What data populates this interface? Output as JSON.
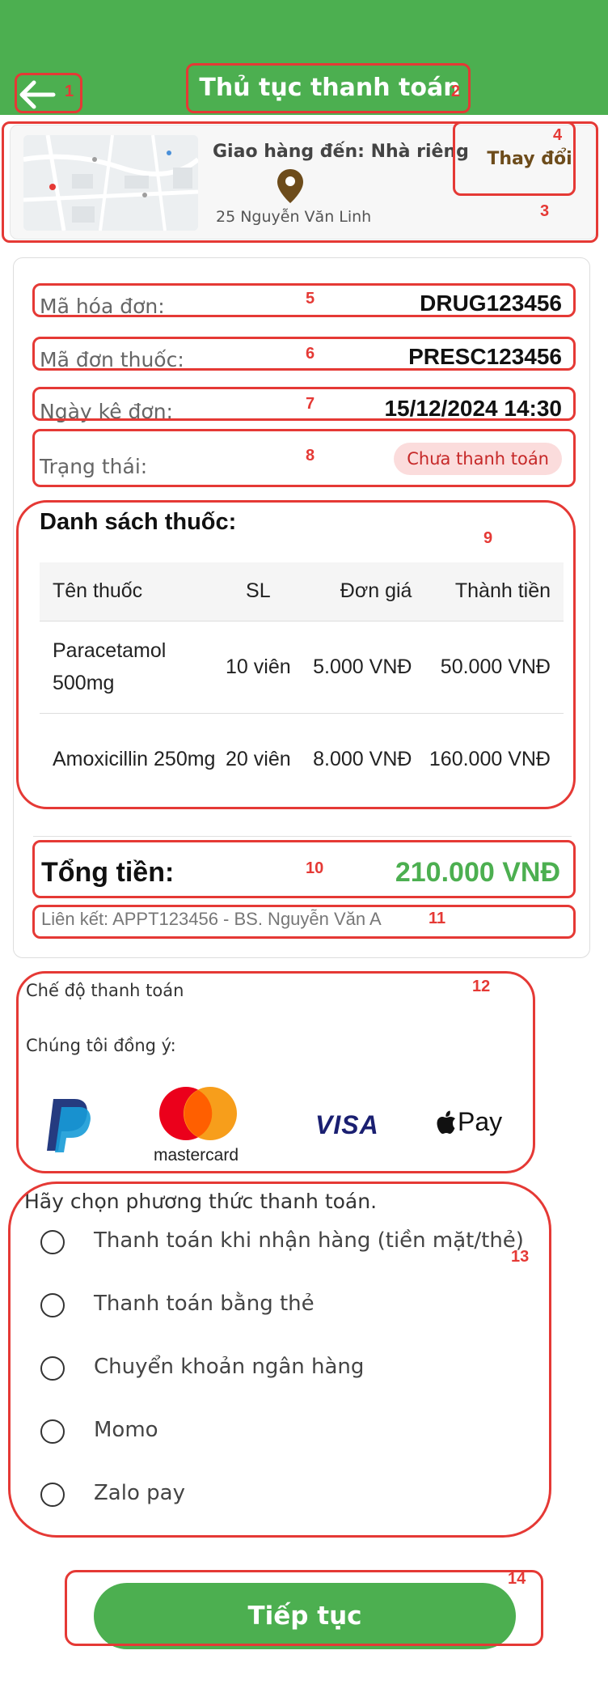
{
  "header": {
    "title": "Thủ tục thanh toán",
    "background_color": "#4caf50",
    "back_icon": "arrow-left-icon"
  },
  "delivery": {
    "title": "Giao hàng đến: Nhà riêng",
    "address": "25 Nguyễn Văn Linh",
    "change_label": "Thay đổi",
    "pin_icon": "location-pin-icon"
  },
  "invoice": {
    "invoice_code_label": "Mã hóa đơn:",
    "invoice_code": "DRUG123456",
    "prescription_code_label": "Mã đơn thuốc:",
    "prescription_code": "PRESC123456",
    "prescribed_date_label": "Ngày kê đơn:",
    "prescribed_date": "15/12/2024 14:30",
    "status_label": "Trạng thái:",
    "status": "Chưa thanh toán",
    "status_color": "#c62828"
  },
  "medicines": {
    "title": "Danh sách thuốc:",
    "headers": [
      "Tên thuốc",
      "SL",
      "Đơn giá",
      "Thành tiền"
    ],
    "rows": [
      {
        "name": "Paracetamol 500mg",
        "qty": "10 viên",
        "price": "5.000 VNĐ",
        "total": "50.000 VNĐ"
      },
      {
        "name": "Amoxicillin 250mg",
        "qty": "20 viên",
        "price": "8.000 VNĐ",
        "total": "160.000 VNĐ"
      }
    ]
  },
  "summary": {
    "total_label": "Tổng tiền:",
    "total_value": "210.000 VNĐ",
    "total_color": "#4caf50",
    "link": "Liên kết: APPT123456 - BS. Nguyễn Văn A"
  },
  "payment_modes": {
    "title": "Chế độ thanh toán",
    "subtitle": "Chúng tôi đồng ý:",
    "logos": [
      "paypal-logo",
      "mastercard-logo",
      "visa-logo",
      "apple-pay-logo"
    ],
    "mastercard_text": "mastercard",
    "visa_text": "VISA",
    "apple_pay_text": "Pay"
  },
  "payment_methods": {
    "title": "Hãy chọn phương thức thanh toán.",
    "options": [
      "Thanh toán khi nhận hàng (tiền mặt/thẻ)",
      "Thanh toán bằng thẻ",
      "Chuyển khoản ngân hàng",
      "Momo",
      "Zalo pay"
    ]
  },
  "continue_label": "Tiếp tục",
  "annotations": [
    "1",
    "2",
    "3",
    "4",
    "5",
    "6",
    "7",
    "8",
    "9",
    "10",
    "11",
    "12",
    "13",
    "14"
  ],
  "annotation_color": "#e53935"
}
